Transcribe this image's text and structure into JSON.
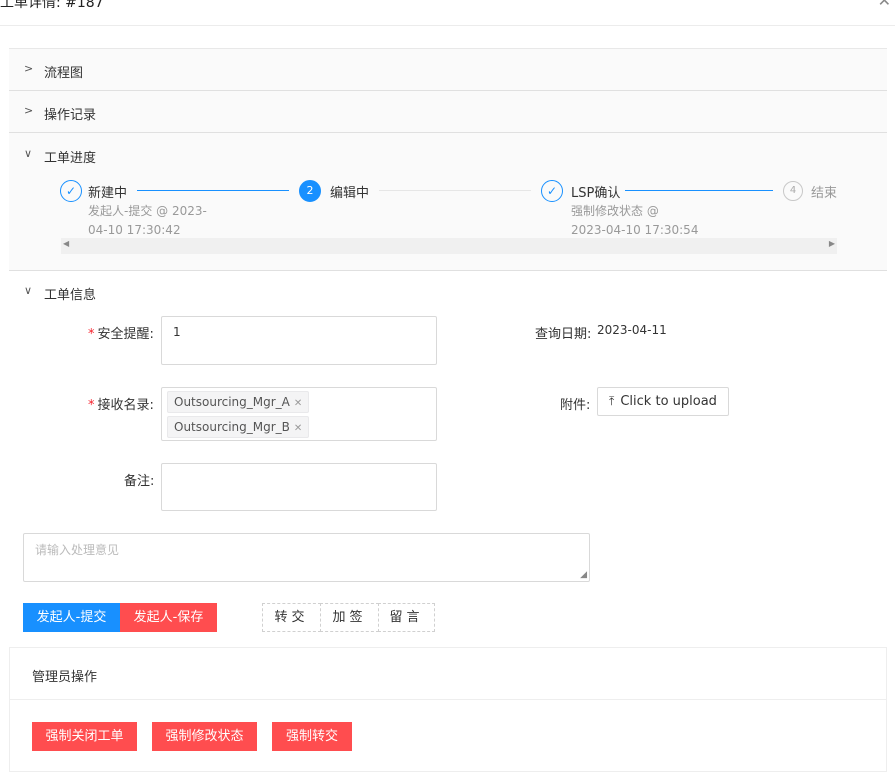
{
  "dialog": {
    "title": "工单详情: #187",
    "close_icon": "close-icon"
  },
  "collapse": {
    "flowchart": {
      "label": "流程图",
      "expanded": false
    },
    "op_log": {
      "label": "操作记录",
      "expanded": false
    },
    "progress": {
      "label": "工单进度",
      "expanded": true
    }
  },
  "steps": [
    {
      "title": "新建中",
      "status": "finished",
      "desc_line1": "发起人-提交 @ 2023-",
      "desc_line2": "04-10 17:30:42"
    },
    {
      "title": "编辑中",
      "status": "active",
      "number": "2"
    },
    {
      "title": "LSP确认",
      "status": "finished",
      "desc_line1": "强制修改状态 @",
      "desc_line2": "2023-04-10 17:30:54"
    },
    {
      "title": "结束",
      "status": "wait",
      "number": "4"
    }
  ],
  "info": {
    "label": "工单信息",
    "safety_reminder": {
      "label": "安全提醒:",
      "value": "1"
    },
    "query_date": {
      "label": "查询日期:",
      "value": "2023-04-11"
    },
    "recipients": {
      "label": "接收名录:",
      "tags": [
        "Outsourcing_Mgr_A",
        "Outsourcing_Mgr_B"
      ]
    },
    "attachment": {
      "label": "附件:",
      "upload_label": "Click to upload"
    },
    "remark": {
      "label": "备注:",
      "value": ""
    }
  },
  "opinion": {
    "placeholder": "请输入处理意见"
  },
  "actions": {
    "submit": "发起人-提交",
    "save": "发起人-保存",
    "transfer": "转交",
    "countersign": "加签",
    "message": "留言"
  },
  "admin": {
    "title": "管理员操作",
    "force_close": "强制关闭工单",
    "force_modify": "强制修改状态",
    "force_transfer": "强制转交"
  },
  "colors": {
    "primary": "#1890ff",
    "danger": "#ff4d4f"
  }
}
